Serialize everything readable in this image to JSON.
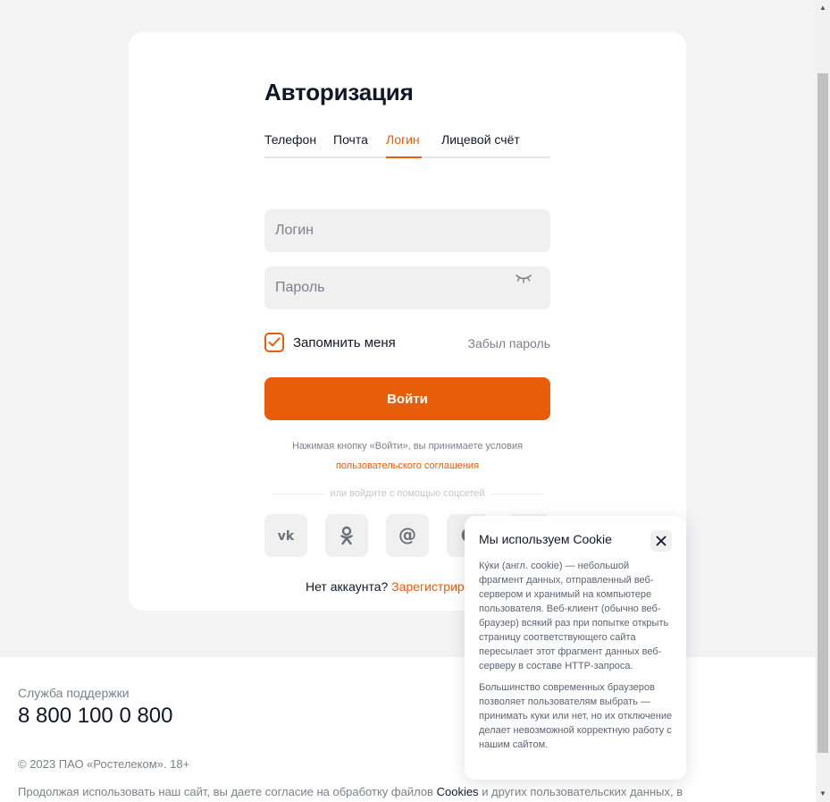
{
  "auth": {
    "title": "Авторизация",
    "tabs": [
      "Телефон",
      "Почта",
      "Логин",
      "Лицевой счёт"
    ],
    "active_tab": "Логин",
    "login_placeholder": "Логин",
    "password_placeholder": "Пароль",
    "remember_label": "Запомнить меня",
    "remember_checked": true,
    "forgot_label": "Забыл пароль",
    "submit_label": "Войти",
    "terms_text": "Нажимая кнопку «Войти», вы принимаете условия",
    "terms_link": "пользовательского соглашения",
    "social_divider": "или войдите с помощью соцсетей",
    "socials": [
      "vk-icon",
      "ok-icon",
      "mail-icon",
      "google-icon",
      "yandex-icon"
    ],
    "no_account_text": "Нет аккаунта?",
    "register_link": "Зарегистрир"
  },
  "footer": {
    "support_label": "Служба поддержки",
    "support_phone": "8 800 100 0 800",
    "copyright": "© 2023 ПАО «Ростелеком». 18+",
    "consent_text": "Продолжая использовать наш сайт, вы даете согласие на обработку файлов",
    "consent_link": "Cookies",
    "consent_tail": "и других пользовательских данных, в"
  },
  "cookie_popup": {
    "title": "Мы используем Cookie",
    "paragraph1": "Ку́ки (англ. cookie) — небольшой фрагмент данных, отправленный веб-сервером и хранимый на компьютере пользователя. Веб-клиент (обычно веб-браузер) всякий раз при попытке открыть страницу соответствующего сайта пересылает этот фрагмент данных веб-серверу в составе HTTP-запроса.",
    "paragraph2": "Большинство современных браузеров позволяет пользователям выбрать — принимать куки или нет, но их отключение делает невозможной корректную работу с нашим сайтом."
  },
  "colors": {
    "accent": "#e85d0a",
    "page_bg": "#f3f3f4",
    "text": "#101828",
    "muted": "#7c8089"
  }
}
